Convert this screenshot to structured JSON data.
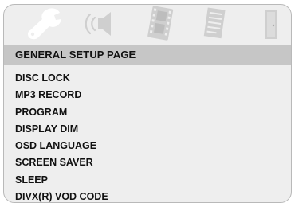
{
  "icon_bar": {
    "tabs": [
      {
        "icon": "wrench-icon",
        "state": "selected"
      },
      {
        "icon": "speaker-icon",
        "state": "inactive"
      },
      {
        "icon": "film-strip-icon",
        "state": "inactive"
      },
      {
        "icon": "document-icon",
        "state": "inactive"
      },
      {
        "icon": "door-icon",
        "state": "inactive"
      }
    ],
    "colors": {
      "selected": "#ffffff",
      "inactive": "#cfcfcf"
    }
  },
  "page": {
    "title": "GENERAL SETUP PAGE",
    "highlight_color": "#c6c6c6",
    "background": "#eeeeee"
  },
  "menu": {
    "items": [
      {
        "label": "DISC LOCK"
      },
      {
        "label": "MP3 RECORD"
      },
      {
        "label": "PROGRAM"
      },
      {
        "label": "DISPLAY DIM"
      },
      {
        "label": "OSD LANGUAGE"
      },
      {
        "label": "SCREEN SAVER"
      },
      {
        "label": "SLEEP"
      },
      {
        "label": "DIVX(R) VOD CODE"
      }
    ]
  }
}
